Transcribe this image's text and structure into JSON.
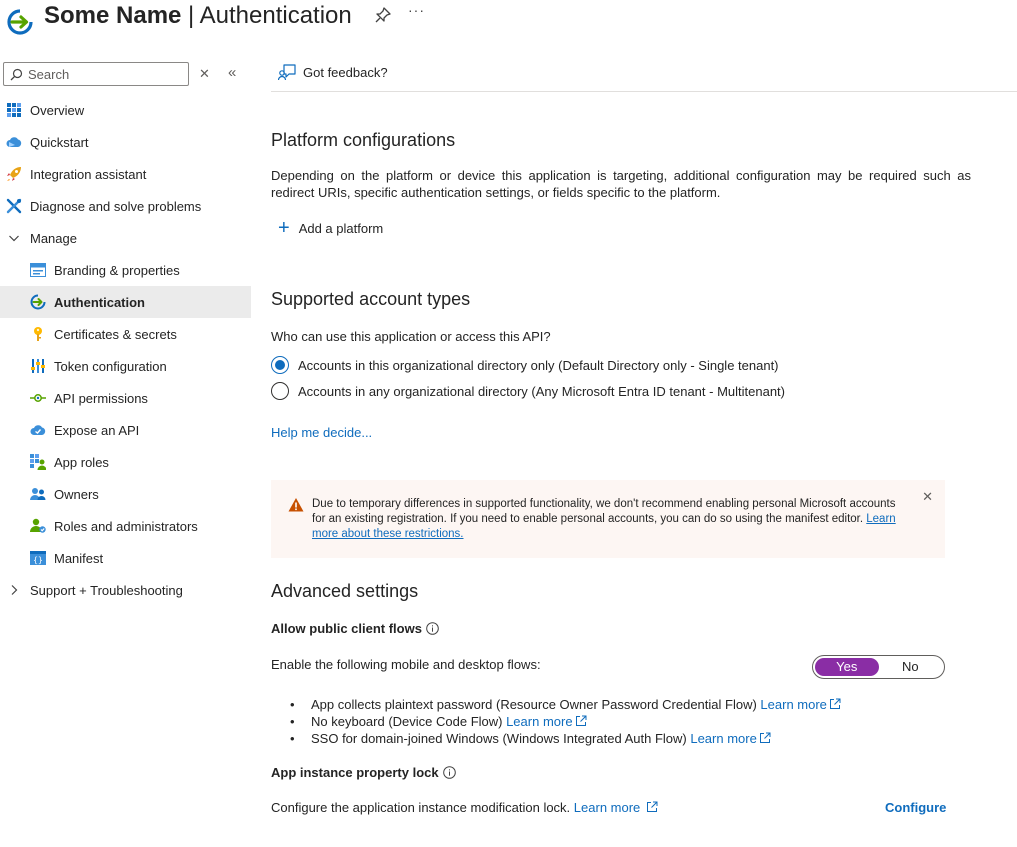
{
  "header": {
    "app_name": "Some Name",
    "separator": " | ",
    "section": "Authentication",
    "more": "···"
  },
  "sidebar": {
    "search_placeholder": "Search",
    "items": [
      {
        "label": "Overview",
        "icon": "overview-icon"
      },
      {
        "label": "Quickstart",
        "icon": "quickstart-icon"
      },
      {
        "label": "Integration assistant",
        "icon": "rocket-icon"
      },
      {
        "label": "Diagnose and solve problems",
        "icon": "wrench-icon"
      },
      {
        "label": "Manage",
        "icon": "chevron-down-icon"
      },
      {
        "label": "Branding & properties",
        "icon": "branding-icon"
      },
      {
        "label": "Authentication",
        "icon": "authentication-icon",
        "active": true
      },
      {
        "label": "Certificates & secrets",
        "icon": "key-icon"
      },
      {
        "label": "Token configuration",
        "icon": "token-icon"
      },
      {
        "label": "API permissions",
        "icon": "api-permissions-icon"
      },
      {
        "label": "Expose an API",
        "icon": "cloud-icon"
      },
      {
        "label": "App roles",
        "icon": "app-roles-icon"
      },
      {
        "label": "Owners",
        "icon": "owners-icon"
      },
      {
        "label": "Roles and administrators",
        "icon": "roles-icon"
      },
      {
        "label": "Manifest",
        "icon": "manifest-icon"
      },
      {
        "label": "Support + Troubleshooting",
        "icon": "chevron-right-icon"
      }
    ]
  },
  "toolbar": {
    "feedback_label": "Got feedback?"
  },
  "platform": {
    "title": "Platform configurations",
    "description": "Depending on the platform or device this application is targeting, additional configuration may be required such as redirect URIs, specific authentication settings, or fields specific to the platform.",
    "add_label": "Add a platform"
  },
  "accounts": {
    "title": "Supported account types",
    "question": "Who can use this application or access this API?",
    "options": [
      {
        "label": "Accounts in this organizational directory only (Default Directory only - Single tenant)",
        "selected": true
      },
      {
        "label": "Accounts in any organizational directory (Any Microsoft Entra ID tenant - Multitenant)",
        "selected": false
      }
    ],
    "help_link": "Help me decide..."
  },
  "warning": {
    "text": "Due to temporary differences in supported functionality, we don't recommend enabling personal Microsoft accounts for an existing registration. If you need to enable personal accounts, you can do so using the manifest editor. ",
    "link": "Learn more about these restrictions.",
    "close": "✕"
  },
  "advanced": {
    "title": "Advanced settings",
    "public_flows_title": "Allow public client flows",
    "flows_label": "Enable the following mobile and desktop flows:",
    "toggle": {
      "yes": "Yes",
      "no": "No",
      "value": "Yes"
    },
    "bullets": [
      {
        "text": "App collects plaintext password (Resource Owner Password Credential Flow) ",
        "link": "Learn more"
      },
      {
        "text": "No keyboard (Device Code Flow) ",
        "link": "Learn more"
      },
      {
        "text": "SSO for domain-joined Windows (Windows Integrated Auth Flow) ",
        "link": "Learn more"
      }
    ],
    "lock_title": "App instance property lock",
    "lock_desc": "Configure the application instance modification lock. ",
    "lock_link": "Learn more",
    "configure": "Configure"
  },
  "colors": {
    "accent": "#0f6cbd",
    "toggle_on": "#8a2da5",
    "warning_bg": "#fdf6f3",
    "warning_icon": "#c75000",
    "active_nav_bg": "#ebebeb"
  }
}
